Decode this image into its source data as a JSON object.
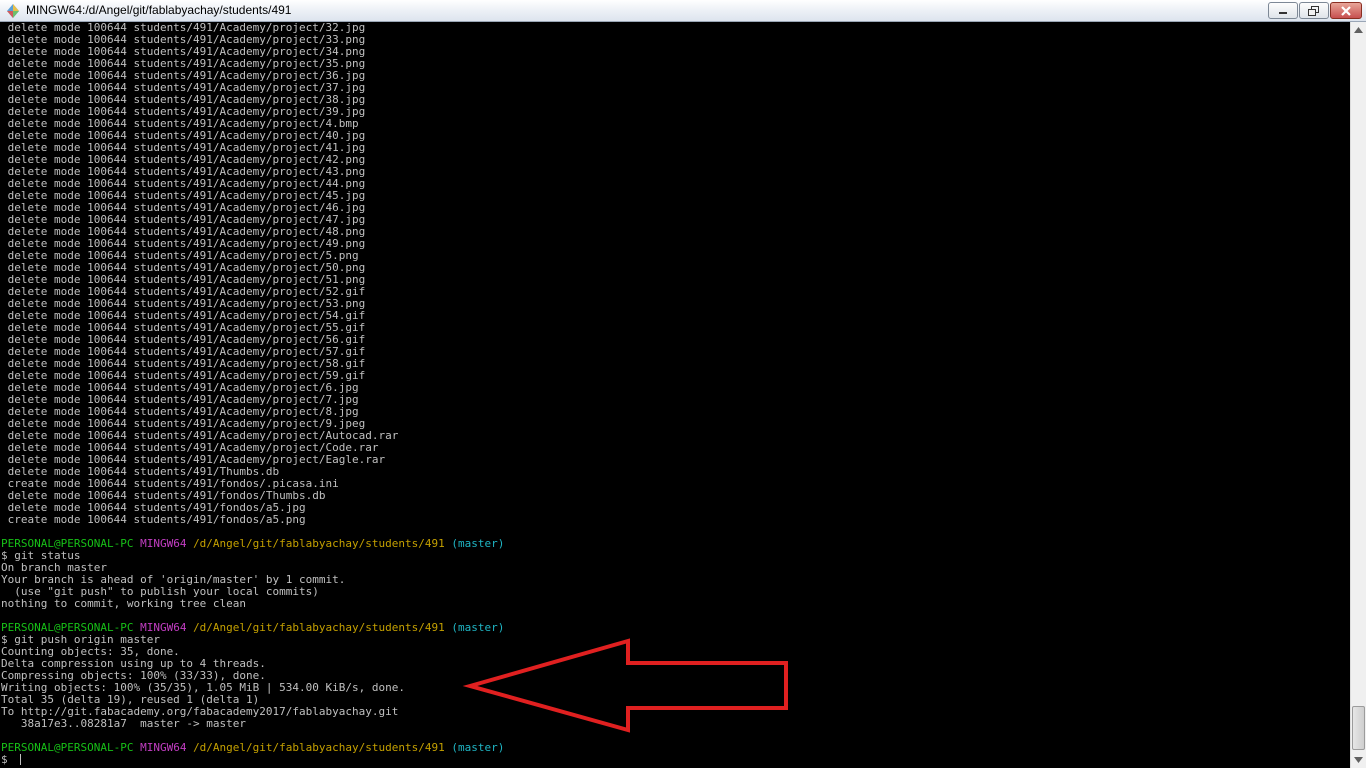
{
  "window": {
    "title": "MINGW64:/d/Angel/git/fablabyachay/students/491",
    "app_icon": "mingw-icon",
    "controls": [
      "minimize-icon",
      "maximize-icon",
      "close-icon"
    ]
  },
  "colors": {
    "background": "#000000",
    "text": "#c0c0c0",
    "prompt_user": "#17c017",
    "prompt_env": "#c33ec3",
    "prompt_path": "#c4a000",
    "prompt_branch": "#1fb5c4",
    "annotation_arrow": "#e02020"
  },
  "terminal": {
    "git_output": [
      " delete mode 100644 students/491/Academy/project/32.jpg",
      " delete mode 100644 students/491/Academy/project/33.png",
      " delete mode 100644 students/491/Academy/project/34.png",
      " delete mode 100644 students/491/Academy/project/35.png",
      " delete mode 100644 students/491/Academy/project/36.jpg",
      " delete mode 100644 students/491/Academy/project/37.jpg",
      " delete mode 100644 students/491/Academy/project/38.jpg",
      " delete mode 100644 students/491/Academy/project/39.jpg",
      " delete mode 100644 students/491/Academy/project/4.bmp",
      " delete mode 100644 students/491/Academy/project/40.jpg",
      " delete mode 100644 students/491/Academy/project/41.jpg",
      " delete mode 100644 students/491/Academy/project/42.png",
      " delete mode 100644 students/491/Academy/project/43.png",
      " delete mode 100644 students/491/Academy/project/44.png",
      " delete mode 100644 students/491/Academy/project/45.jpg",
      " delete mode 100644 students/491/Academy/project/46.jpg",
      " delete mode 100644 students/491/Academy/project/47.jpg",
      " delete mode 100644 students/491/Academy/project/48.png",
      " delete mode 100644 students/491/Academy/project/49.png",
      " delete mode 100644 students/491/Academy/project/5.png",
      " delete mode 100644 students/491/Academy/project/50.png",
      " delete mode 100644 students/491/Academy/project/51.png",
      " delete mode 100644 students/491/Academy/project/52.gif",
      " delete mode 100644 students/491/Academy/project/53.png",
      " delete mode 100644 students/491/Academy/project/54.gif",
      " delete mode 100644 students/491/Academy/project/55.gif",
      " delete mode 100644 students/491/Academy/project/56.gif",
      " delete mode 100644 students/491/Academy/project/57.gif",
      " delete mode 100644 students/491/Academy/project/58.gif",
      " delete mode 100644 students/491/Academy/project/59.gif",
      " delete mode 100644 students/491/Academy/project/6.jpg",
      " delete mode 100644 students/491/Academy/project/7.jpg",
      " delete mode 100644 students/491/Academy/project/8.jpg",
      " delete mode 100644 students/491/Academy/project/9.jpeg",
      " delete mode 100644 students/491/Academy/project/Autocad.rar",
      " delete mode 100644 students/491/Academy/project/Code.rar",
      " delete mode 100644 students/491/Academy/project/Eagle.rar",
      " delete mode 100644 students/491/Thumbs.db",
      " create mode 100644 students/491/fondos/.picasa.ini",
      " delete mode 100644 students/491/fondos/Thumbs.db",
      " delete mode 100644 students/491/fondos/a5.jpg",
      " create mode 100644 students/491/fondos/a5.png"
    ],
    "prompt": {
      "user": "PERSONAL@PERSONAL-PC",
      "env": "MINGW64",
      "path": "/d/Angel/git/fablabyachay/students/491",
      "branch": "(master)"
    },
    "status_command": "$ git status",
    "status_output": [
      "On branch master",
      "Your branch is ahead of 'origin/master' by 1 commit.",
      "  (use \"git push\" to publish your local commits)",
      "nothing to commit, working tree clean"
    ],
    "push_command": "$ git push origin master",
    "push_output": [
      "Counting objects: 35, done.",
      "Delta compression using up to 4 threads.",
      "Compressing objects: 100% (33/33), done.",
      "Writing objects: 100% (35/35), 1.05 MiB | 534.00 KiB/s, done.",
      "Total 35 (delta 19), reused 1 (delta 1)",
      "To http://git.fabacademy.org/fabacademy2017/fablabyachay.git",
      "   38a17e3..08281a7  master -> master"
    ],
    "input_prompt": "$ "
  },
  "scrollbar": {
    "up_icon": "scroll-up-arrow-icon",
    "down_icon": "scroll-down-arrow-icon",
    "scroll_fraction": 1.0
  },
  "annotation": {
    "icon": "red-arrow-outline-icon"
  }
}
